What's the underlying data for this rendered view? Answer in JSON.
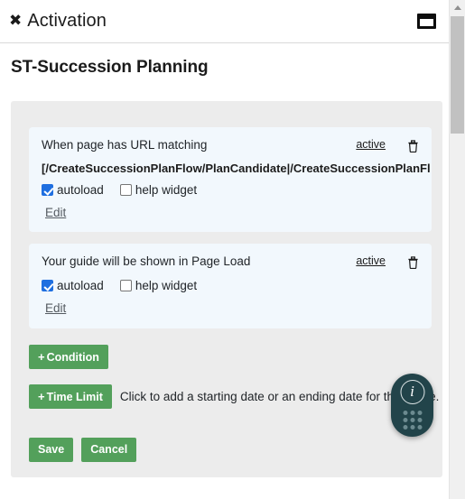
{
  "header": {
    "close_label": "✖",
    "title": "Activation",
    "window_icon_name": "restore-window-icon"
  },
  "page": {
    "title": "ST-Succession Planning"
  },
  "conditions": [
    {
      "label": "When page has URL matching",
      "status": "active",
      "url": "[/CreateSuccessionPlanFlow/PlanCandidate|/CreateSuccessionPlanFlow/SuccessionP",
      "autoload_label": "autoload",
      "autoload_checked": true,
      "help_widget_label": "help widget",
      "help_widget_checked": false,
      "edit_label": "Edit"
    },
    {
      "label": "Your guide will be shown in Page Load",
      "status": "active",
      "url": null,
      "autoload_label": "autoload",
      "autoload_checked": true,
      "help_widget_label": "help widget",
      "help_widget_checked": false,
      "edit_label": "Edit"
    }
  ],
  "actions": {
    "plus_glyph": "+",
    "add_condition_label": "Condition",
    "add_time_limit_label": "Time Limit",
    "time_limit_hint": "Click to add a starting date or an ending date for this guide.",
    "save_label": "Save",
    "cancel_label": "Cancel"
  },
  "info_widget": {
    "icon_letter": "i",
    "name": "info-help-widget"
  },
  "colors": {
    "green_button": "#53a05b",
    "card_background": "#f2f8fd",
    "panel_background": "#ececec",
    "widget_background": "#22444a",
    "checkbox_checked": "#1f6fe0"
  }
}
